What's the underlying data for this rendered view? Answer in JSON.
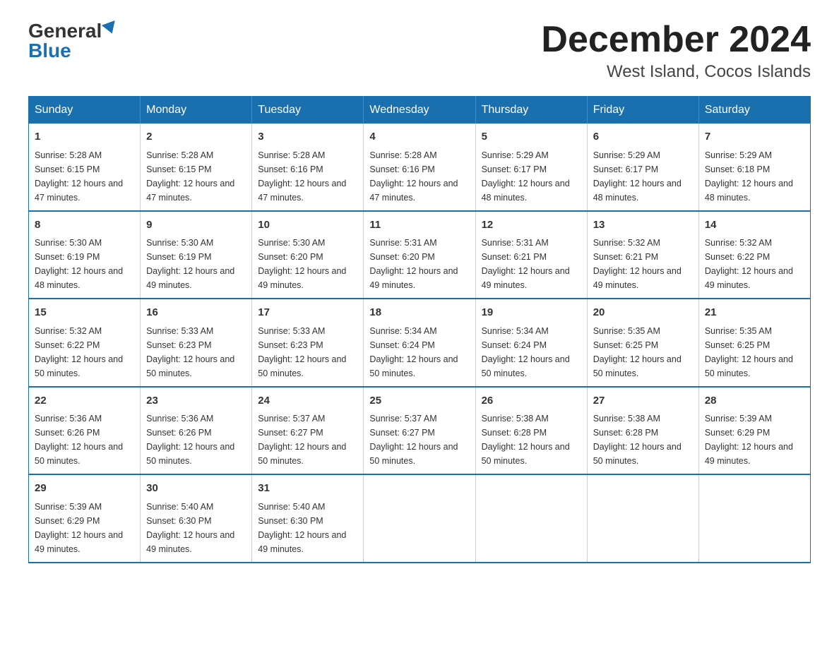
{
  "logo": {
    "general": "General",
    "blue": "Blue"
  },
  "header": {
    "month": "December 2024",
    "location": "West Island, Cocos Islands"
  },
  "weekdays": [
    "Sunday",
    "Monday",
    "Tuesday",
    "Wednesday",
    "Thursday",
    "Friday",
    "Saturday"
  ],
  "weeks": [
    [
      {
        "day": "1",
        "sunrise": "5:28 AM",
        "sunset": "6:15 PM",
        "daylight": "12 hours and 47 minutes."
      },
      {
        "day": "2",
        "sunrise": "5:28 AM",
        "sunset": "6:15 PM",
        "daylight": "12 hours and 47 minutes."
      },
      {
        "day": "3",
        "sunrise": "5:28 AM",
        "sunset": "6:16 PM",
        "daylight": "12 hours and 47 minutes."
      },
      {
        "day": "4",
        "sunrise": "5:28 AM",
        "sunset": "6:16 PM",
        "daylight": "12 hours and 47 minutes."
      },
      {
        "day": "5",
        "sunrise": "5:29 AM",
        "sunset": "6:17 PM",
        "daylight": "12 hours and 48 minutes."
      },
      {
        "day": "6",
        "sunrise": "5:29 AM",
        "sunset": "6:17 PM",
        "daylight": "12 hours and 48 minutes."
      },
      {
        "day": "7",
        "sunrise": "5:29 AM",
        "sunset": "6:18 PM",
        "daylight": "12 hours and 48 minutes."
      }
    ],
    [
      {
        "day": "8",
        "sunrise": "5:30 AM",
        "sunset": "6:19 PM",
        "daylight": "12 hours and 48 minutes."
      },
      {
        "day": "9",
        "sunrise": "5:30 AM",
        "sunset": "6:19 PM",
        "daylight": "12 hours and 49 minutes."
      },
      {
        "day": "10",
        "sunrise": "5:30 AM",
        "sunset": "6:20 PM",
        "daylight": "12 hours and 49 minutes."
      },
      {
        "day": "11",
        "sunrise": "5:31 AM",
        "sunset": "6:20 PM",
        "daylight": "12 hours and 49 minutes."
      },
      {
        "day": "12",
        "sunrise": "5:31 AM",
        "sunset": "6:21 PM",
        "daylight": "12 hours and 49 minutes."
      },
      {
        "day": "13",
        "sunrise": "5:32 AM",
        "sunset": "6:21 PM",
        "daylight": "12 hours and 49 minutes."
      },
      {
        "day": "14",
        "sunrise": "5:32 AM",
        "sunset": "6:22 PM",
        "daylight": "12 hours and 49 minutes."
      }
    ],
    [
      {
        "day": "15",
        "sunrise": "5:32 AM",
        "sunset": "6:22 PM",
        "daylight": "12 hours and 50 minutes."
      },
      {
        "day": "16",
        "sunrise": "5:33 AM",
        "sunset": "6:23 PM",
        "daylight": "12 hours and 50 minutes."
      },
      {
        "day": "17",
        "sunrise": "5:33 AM",
        "sunset": "6:23 PM",
        "daylight": "12 hours and 50 minutes."
      },
      {
        "day": "18",
        "sunrise": "5:34 AM",
        "sunset": "6:24 PM",
        "daylight": "12 hours and 50 minutes."
      },
      {
        "day": "19",
        "sunrise": "5:34 AM",
        "sunset": "6:24 PM",
        "daylight": "12 hours and 50 minutes."
      },
      {
        "day": "20",
        "sunrise": "5:35 AM",
        "sunset": "6:25 PM",
        "daylight": "12 hours and 50 minutes."
      },
      {
        "day": "21",
        "sunrise": "5:35 AM",
        "sunset": "6:25 PM",
        "daylight": "12 hours and 50 minutes."
      }
    ],
    [
      {
        "day": "22",
        "sunrise": "5:36 AM",
        "sunset": "6:26 PM",
        "daylight": "12 hours and 50 minutes."
      },
      {
        "day": "23",
        "sunrise": "5:36 AM",
        "sunset": "6:26 PM",
        "daylight": "12 hours and 50 minutes."
      },
      {
        "day": "24",
        "sunrise": "5:37 AM",
        "sunset": "6:27 PM",
        "daylight": "12 hours and 50 minutes."
      },
      {
        "day": "25",
        "sunrise": "5:37 AM",
        "sunset": "6:27 PM",
        "daylight": "12 hours and 50 minutes."
      },
      {
        "day": "26",
        "sunrise": "5:38 AM",
        "sunset": "6:28 PM",
        "daylight": "12 hours and 50 minutes."
      },
      {
        "day": "27",
        "sunrise": "5:38 AM",
        "sunset": "6:28 PM",
        "daylight": "12 hours and 50 minutes."
      },
      {
        "day": "28",
        "sunrise": "5:39 AM",
        "sunset": "6:29 PM",
        "daylight": "12 hours and 49 minutes."
      }
    ],
    [
      {
        "day": "29",
        "sunrise": "5:39 AM",
        "sunset": "6:29 PM",
        "daylight": "12 hours and 49 minutes."
      },
      {
        "day": "30",
        "sunrise": "5:40 AM",
        "sunset": "6:30 PM",
        "daylight": "12 hours and 49 minutes."
      },
      {
        "day": "31",
        "sunrise": "5:40 AM",
        "sunset": "6:30 PM",
        "daylight": "12 hours and 49 minutes."
      },
      null,
      null,
      null,
      null
    ]
  ]
}
